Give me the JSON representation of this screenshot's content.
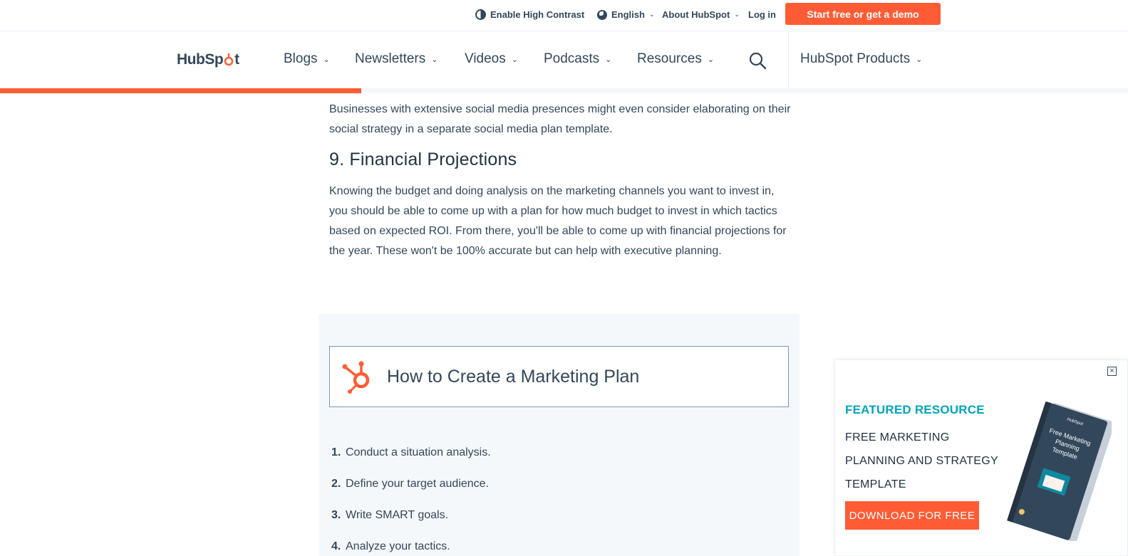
{
  "utility_bar": {
    "high_contrast_label": "Enable High Contrast",
    "language_label": "English",
    "about_label": "About HubSpot",
    "login_label": "Log in",
    "cta_label": "Start free or get a demo"
  },
  "nav": {
    "logo_text_a": "HubSp",
    "logo_text_b": "t",
    "items": [
      {
        "label": "Blogs"
      },
      {
        "label": "Newsletters"
      },
      {
        "label": "Videos"
      },
      {
        "label": "Podcasts"
      },
      {
        "label": "Resources"
      }
    ],
    "products_label": "HubSpot Products"
  },
  "reading_progress": 0.32,
  "article": {
    "intro_paragraph": "Businesses with extensive social media presences might even consider elaborating on their social strategy in a separate social media plan template.",
    "section_heading": "9. Financial Projections",
    "section_paragraph": "Knowing the budget and doing analysis on the marketing channels you want to invest in, you should be able to come up with a plan for how much budget to invest in which tactics based on expected ROI. From there, you'll be able to come up with financial projections for the year. These won't be 100% accurate but can help with executive planning."
  },
  "callout": {
    "title": "How to Create a Marketing Plan",
    "steps": [
      {
        "num": "1.",
        "text": "Conduct a situation analysis."
      },
      {
        "num": "2.",
        "text": "Define your target audience."
      },
      {
        "num": "3.",
        "text": "Write SMART goals."
      },
      {
        "num": "4.",
        "text": "Analyze your tactics."
      }
    ]
  },
  "featured": {
    "label": "FEATURED RESOURCE",
    "title": "FREE MARKETING PLANNING AND STRATEGY TEMPLATE",
    "button_label": "DOWNLOAD FOR FREE",
    "book_title": "Free Marketing Planning Template",
    "book_brand": "HubSpot"
  },
  "colors": {
    "brand_orange": "#ff5c35",
    "text_dark": "#33475b",
    "accent_teal": "#00a4bd",
    "callout_bg": "#f5f8fa"
  }
}
